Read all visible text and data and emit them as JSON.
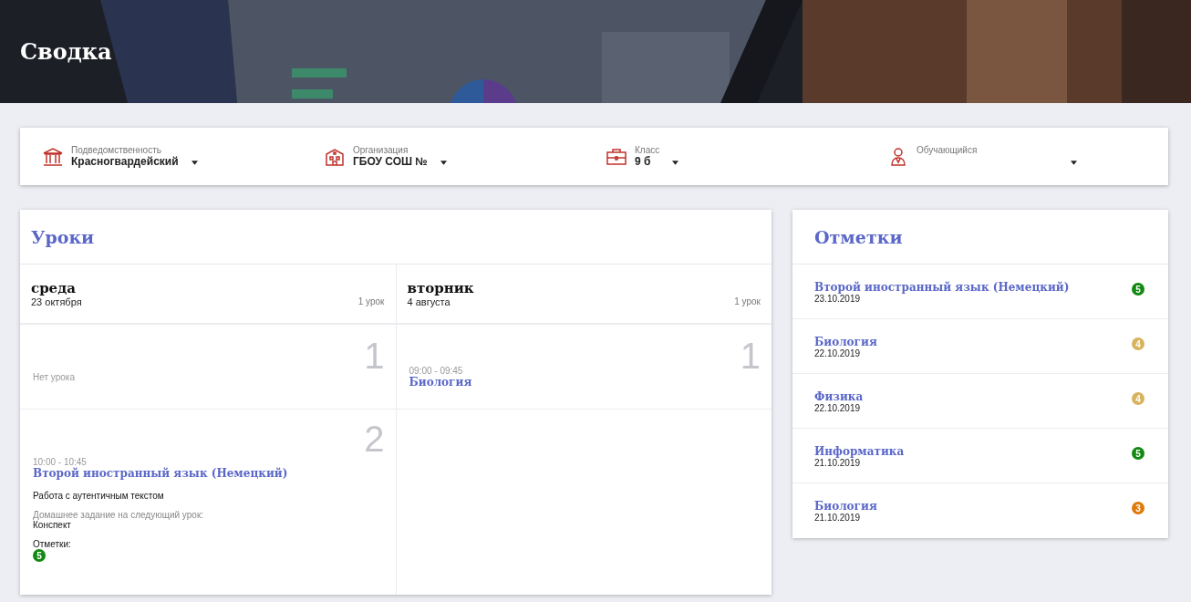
{
  "header": {
    "title": "Сводка",
    "kind": "picture"
  },
  "filters": [
    {
      "kind": "institution",
      "label": "Подведомственность",
      "value": "Красногвардейский"
    },
    {
      "kind": "organization",
      "label": "Организация",
      "value": "ГБОУ СОШ №"
    },
    {
      "kind": "class",
      "label": "Класс",
      "value": "9 б"
    },
    {
      "kind": "student",
      "label": "Обучающийся"
    }
  ],
  "lessons": {
    "title": "Уроки",
    "days": [
      {
        "name": "среда",
        "date": "23 октября",
        "count": "1 урок",
        "slots": [
          {
            "kind": "empty",
            "number": "1",
            "text": "Нет урока"
          },
          {
            "kind": "lesson",
            "number": "2",
            "time": "10:00 - 10:45",
            "subject": "Второй иностранный язык (Немецкий)",
            "topic": "Работа с аутентичным текстом",
            "homework_label": "Домашнее задание на следующий урок:",
            "homework": "Конспект",
            "marks_label": "Отметки:",
            "marks": [
              {
                "grade": "5",
                "color": "#128a12"
              }
            ]
          }
        ]
      },
      {
        "name": "вторник",
        "date": "4 августа",
        "count": "1 урок",
        "slots": [
          {
            "kind": "lesson",
            "number": "1",
            "time": "09:00 - 09:45",
            "subject": "Биология"
          }
        ]
      }
    ]
  },
  "marks": {
    "title": "Отметки",
    "items": [
      {
        "subject": "Второй иностранный язык (Немецкий)",
        "date": "23.10.2019",
        "grade": "5",
        "color": "#128a12"
      },
      {
        "subject": "Биология",
        "date": "22.10.2019",
        "grade": "4",
        "color": "#d8b35e"
      },
      {
        "subject": "Физика",
        "date": "22.10.2019",
        "grade": "4",
        "color": "#d8b35e"
      },
      {
        "subject": "Информатика",
        "date": "21.10.2019",
        "grade": "5",
        "color": "#128a12"
      },
      {
        "subject": "Биология",
        "date": "21.10.2019",
        "grade": "3",
        "color": "#e07a0c"
      }
    ]
  }
}
